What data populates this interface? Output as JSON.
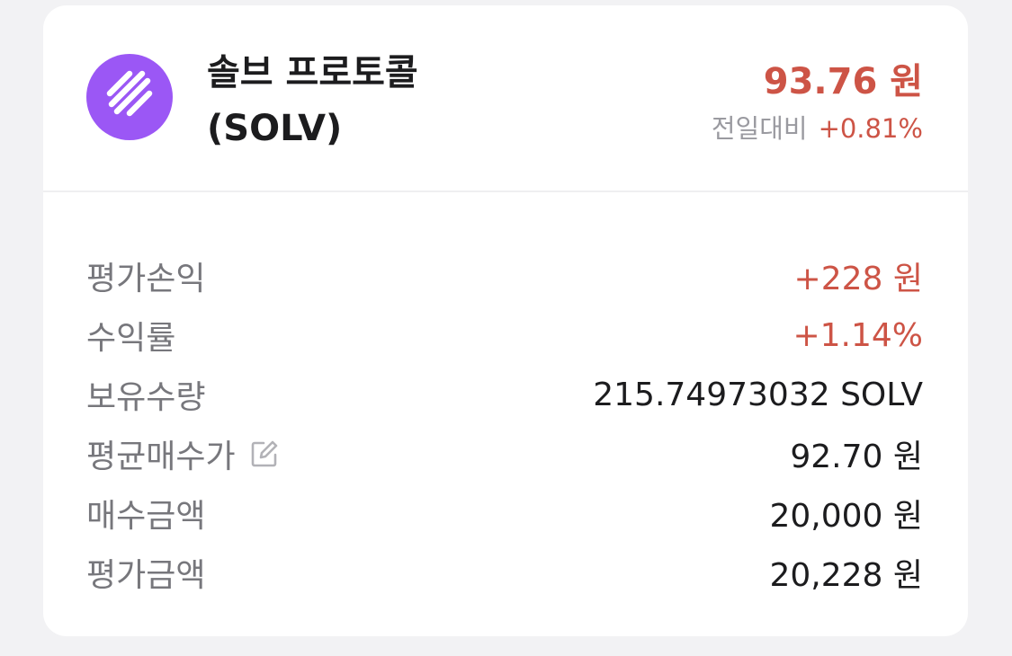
{
  "coin": {
    "name": "솔브 프로토콜",
    "symbol": "(SOLV)",
    "logo_icon": "solv-logo-icon",
    "brand_color": "#9b57f5"
  },
  "price": {
    "value": "93.76 원",
    "change_label": "전일대비",
    "change_value": "+0.81%"
  },
  "holdings": [
    {
      "label": "평가손익",
      "value": "+228 원"
    },
    {
      "label": "수익률",
      "value": "+1.14%"
    },
    {
      "label": "보유수량",
      "value": "215.74973032 SOLV"
    },
    {
      "label": "평균매수가",
      "value": "92.70 원",
      "icon": "edit-icon"
    },
    {
      "label": "매수금액",
      "value": "20,000 원"
    },
    {
      "label": "평가금액",
      "value": "20,228 원"
    }
  ],
  "colors": {
    "positive": "#cd5446",
    "label": "#77777c",
    "text": "#1c1c1e"
  }
}
